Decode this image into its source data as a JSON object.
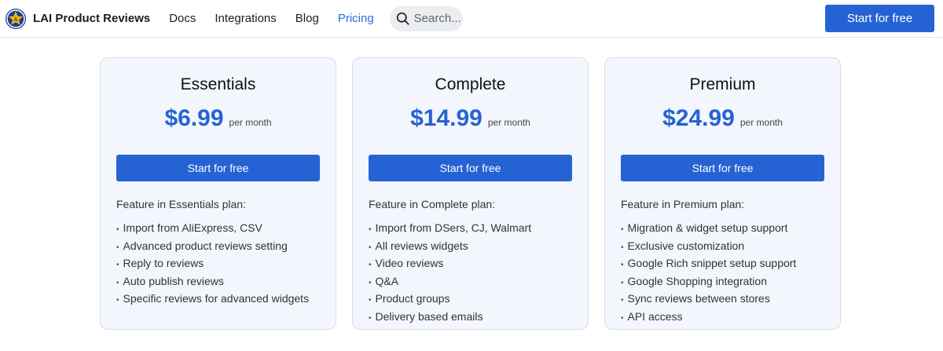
{
  "nav": {
    "brand": "LAI Product Reviews",
    "links": [
      "Docs",
      "Integrations",
      "Blog",
      "Pricing"
    ],
    "active": "Pricing",
    "search_placeholder": "Search...",
    "cta": "Start for free"
  },
  "plans": [
    {
      "name": "Essentials",
      "price": "$6.99",
      "period": "per month",
      "cta": "Start for free",
      "feature_title": "Feature in Essentials plan:",
      "features": [
        "Import from AliExpress, CSV",
        "Advanced product reviews setting",
        "Reply to reviews",
        "Auto publish reviews",
        "Specific reviews for advanced widgets"
      ]
    },
    {
      "name": "Complete",
      "price": "$14.99",
      "period": "per month",
      "cta": "Start for free",
      "feature_title": "Feature in Complete plan:",
      "features": [
        "Import from DSers, CJ, Walmart",
        "All reviews widgets",
        "Video reviews",
        "Q&A",
        "Product groups",
        "Delivery based emails"
      ]
    },
    {
      "name": "Premium",
      "price": "$24.99",
      "period": "per month",
      "cta": "Start for free",
      "feature_title": "Feature in Premium plan:",
      "features": [
        "Migration & widget setup support",
        "Exclusive customization",
        "Google Rich snippet setup support",
        "Google Shopping integration",
        "Sync reviews between stores",
        "API access"
      ]
    }
  ],
  "colors": {
    "accent": "#2563d4",
    "card_bg": "#f3f6fc",
    "logo_bg": "#1a3d8f",
    "logo_star": "#f5b800"
  },
  "icons": {
    "logo": "star-logo-icon",
    "search": "search-icon"
  }
}
